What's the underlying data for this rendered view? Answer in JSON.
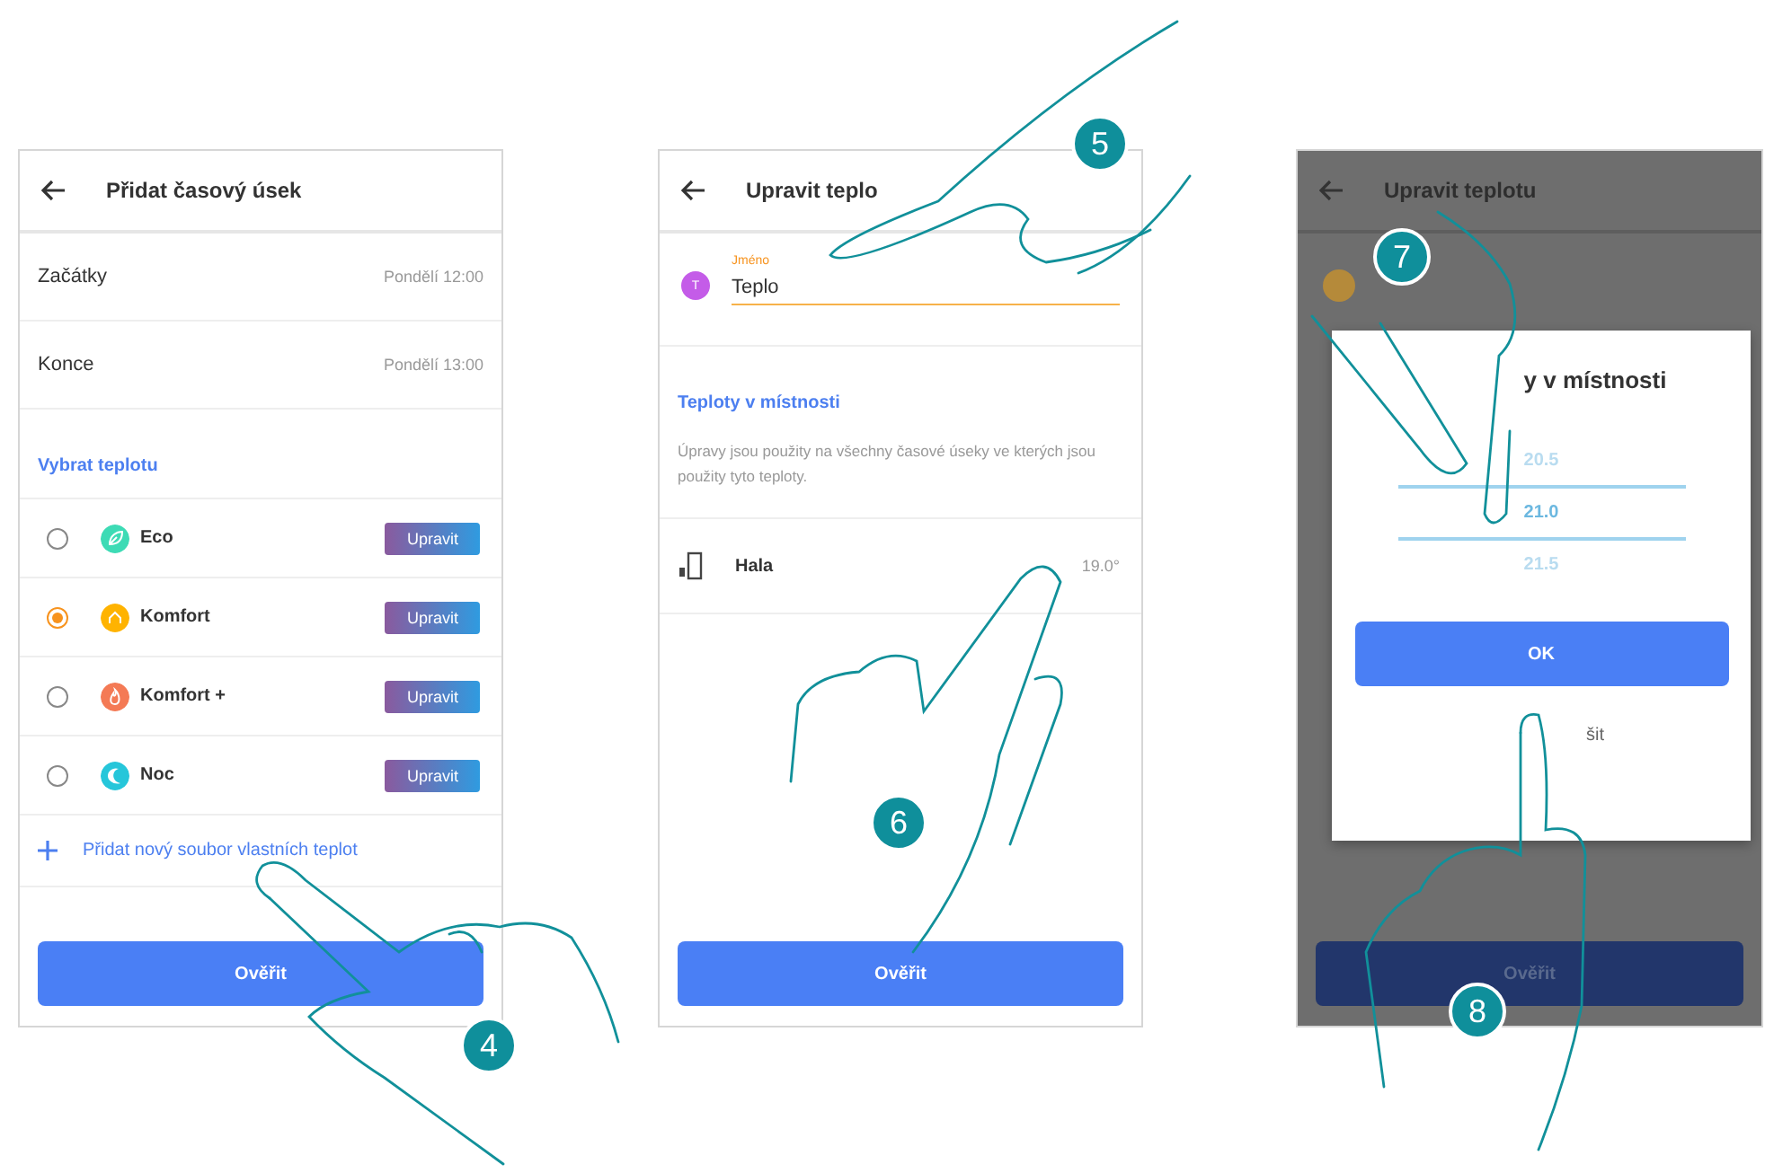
{
  "screens": [
    {
      "kind": "slot",
      "title": "Přidat časový úsek",
      "rows": [
        {
          "label": "Začátky",
          "value": "Pondělí 12:00"
        },
        {
          "label": "Konce",
          "value": "Pondělí 13:00"
        }
      ],
      "section": "Vybrat teplotu",
      "options": [
        {
          "name": "Eco",
          "kind": "leaf",
          "color": "#3ddbb5",
          "selected": false,
          "action": "Upravit"
        },
        {
          "name": "Komfort",
          "kind": "home",
          "color": "#ffb300",
          "selected": true,
          "action": "Upravit"
        },
        {
          "name": "Komfort +",
          "kind": "flame",
          "color": "#f47a55",
          "selected": false,
          "action": "Upravit"
        },
        {
          "name": "Noc",
          "kind": "moon",
          "color": "#26c6da",
          "selected": false,
          "action": "Upravit"
        }
      ],
      "add_link": "Přidat nový soubor vlastních teplot",
      "confirm": "Ověřit"
    },
    {
      "kind": "edit",
      "title": "Upravit teplo",
      "field": {
        "label": "Jméno",
        "value": "Teplo",
        "avatar": "T"
      },
      "section": "Teploty v místnosti",
      "note": "Úpravy jsou použity na všechny časové úseky ve kterých jsou použity tyto teploty.",
      "rooms": [
        {
          "name": "Hala",
          "value": "19.0°"
        }
      ],
      "confirm": "Ověřit"
    },
    {
      "kind": "picker",
      "title": "Upravit teplotu",
      "dialog": {
        "title": "y v místnosti",
        "options": [
          {
            "value": "20.5",
            "selected": false
          },
          {
            "value": "21.0",
            "selected": true
          },
          {
            "value": "21.5",
            "selected": false
          }
        ],
        "ok": "OK",
        "cancel": "šit"
      },
      "confirm": "Ověřit"
    }
  ],
  "steps": [
    "4",
    "5",
    "6",
    "7",
    "8"
  ]
}
